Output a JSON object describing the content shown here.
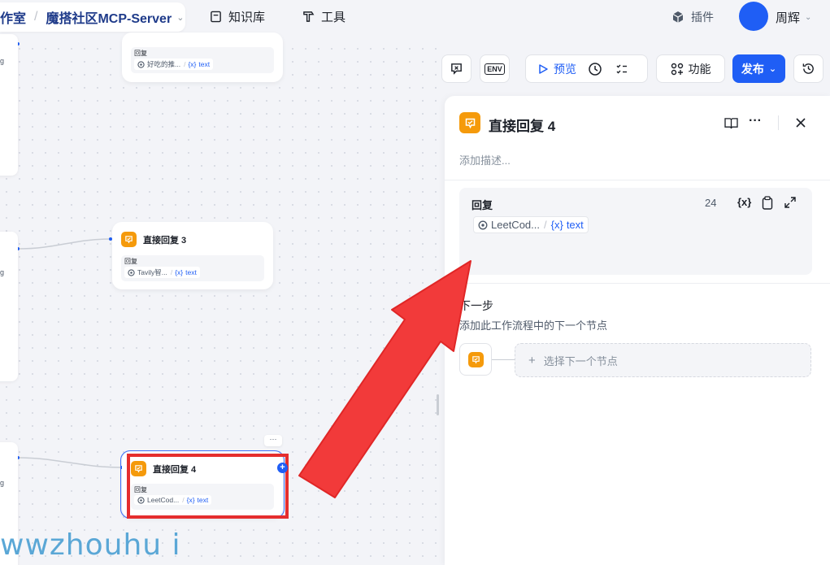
{
  "breadcrumb": {
    "workspace": "作室",
    "project": "魔搭社区MCP-Server"
  },
  "topnav": {
    "knowledge": "知识库",
    "tools": "工具",
    "plugins": "插件",
    "user": "周辉"
  },
  "canvas": {
    "node_top": {
      "label": "回复",
      "value": "好吃的推...",
      "var": "text"
    },
    "node3": {
      "title": "直接回复 3",
      "label": "回复",
      "value": "Tavily智...",
      "var": "text"
    },
    "node4": {
      "title": "直接回复 4",
      "label": "回复",
      "value": "LeetCod...",
      "var": "text"
    },
    "stub_text": "g",
    "watermark": "wwzhouhu i"
  },
  "toolbar": {
    "preview": "预览",
    "features": "功能",
    "publish": "发布",
    "env": "ENV"
  },
  "panel": {
    "title": "直接回复 4",
    "description_placeholder": "添加描述...",
    "reply_label": "回复",
    "char_count": "24",
    "reply_value": "LeetCod...",
    "reply_var": "text",
    "next_title": "下一步",
    "next_desc": "添加此工作流程中的下一个节点",
    "next_select": "选择下一个节点"
  },
  "colors": {
    "accent": "#1f5ef5",
    "node_icon": "#f59a0b",
    "annotation": "#e52e2e"
  }
}
